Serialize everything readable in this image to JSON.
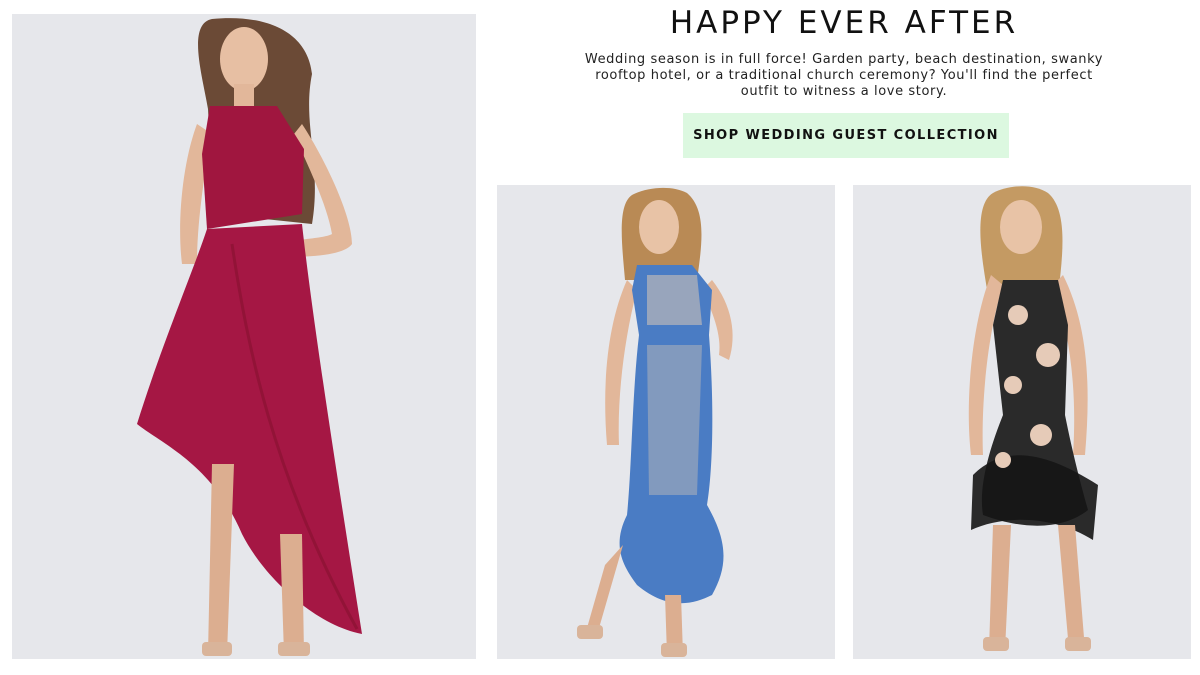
{
  "promo": {
    "headline": "HAPPY EVER AFTER",
    "intro": "Wedding season is in full force! Garden party, beach destination, swanky rooftop hotel, or a traditional church ceremony? You'll find the perfect outfit to witness a love story.",
    "cta_label": "SHOP WEDDING GUEST COLLECTION",
    "cta_color": "#dcf8e0"
  },
  "products": [
    {
      "dress": "burgundy asymmetric high-low halter dress",
      "color": "#a0163f"
    },
    {
      "dress": "blue lace mermaid midi dress",
      "color": "#4a7cc4"
    },
    {
      "dress": "black mesh floral embroidered dress",
      "color": "#1a1a1a"
    }
  ],
  "colors": {
    "photo_background": "#e6e7eb",
    "text": "#111111"
  }
}
